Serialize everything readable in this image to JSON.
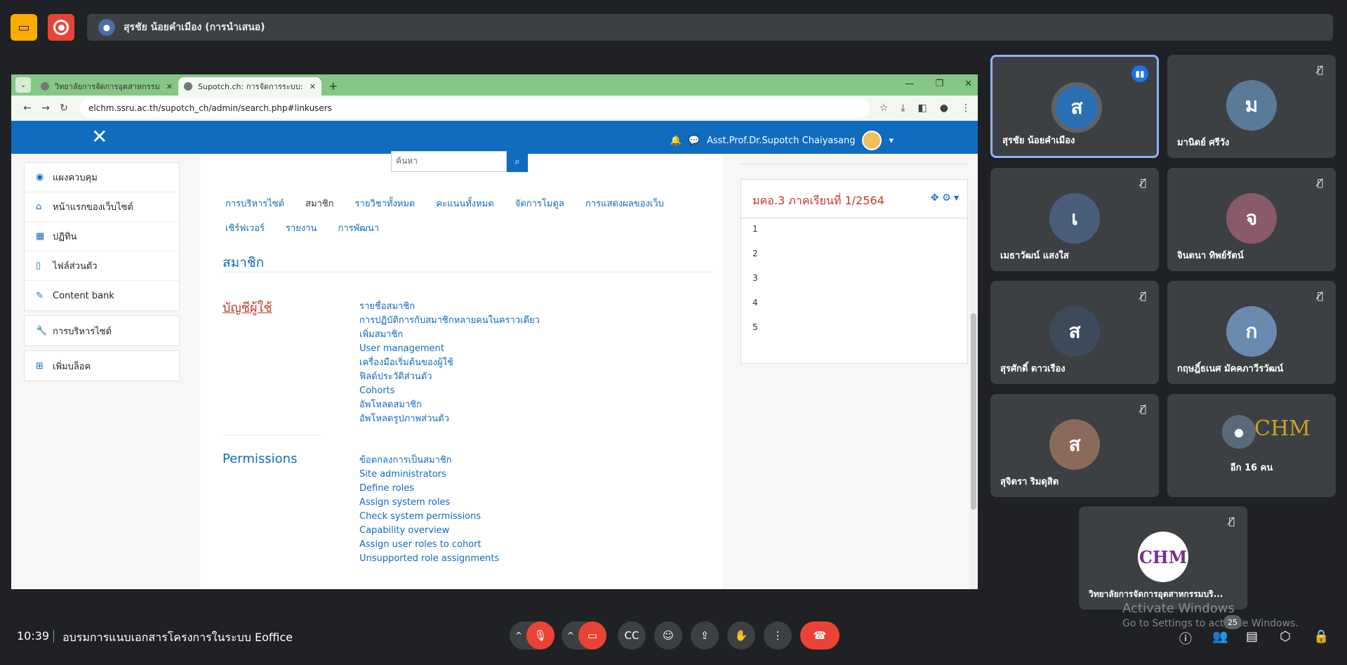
{
  "top": {
    "presenter": "สุรชัย น้อยคำเมือง (การนำเสนอ)"
  },
  "browser": {
    "tabs": [
      {
        "label": "วิทยาลัยการจัดการอุตสาหกรรม และ"
      },
      {
        "label": "Supotch.ch: การจัดการระบบ: ค้นหา"
      }
    ],
    "url": "elchm.ssru.ac.th/supotch_ch/admin/search.php#linkusers"
  },
  "moodle": {
    "user": "Asst.Prof.Dr.Supotch Chaiyasang",
    "nav": [
      {
        "label": "แผงควบคุม",
        "icon": "dashboard-icon"
      },
      {
        "label": "หน้าแรกของเว็บไซต์",
        "icon": "home-icon"
      },
      {
        "label": "ปฏิทิน",
        "icon": "calendar-icon"
      },
      {
        "label": "ไฟล์ส่วนตัว",
        "icon": "file-icon"
      },
      {
        "label": "Content bank",
        "icon": "brush-icon"
      }
    ],
    "nav2": {
      "label": "การบริหารไซต์"
    },
    "nav3": {
      "label": "เพิ่มบล็อค"
    },
    "search_placeholder": "ค้นหา",
    "cat_tabs": [
      "การบริหารไซต์",
      "สมาชิก",
      "รายวิชาทั้งหมด",
      "คะแนนทั้งหมด",
      "จัดการโมดูล",
      "การแสดงผลของเว็บ",
      "เซิร์ฟเวอร์",
      "รายงาน",
      "การพัฒนา"
    ],
    "section_title": "สมาชิก",
    "accounts_title": "บัญชีผู้ใช้",
    "accounts_links": [
      "รายชื่อสมาชิก",
      "การปฏิบัติการกับสมาชิกหลายคนในคราวเดียว",
      "เพิ่มสมาชิก",
      "User management",
      "เครื่องมือเริ่มต้นของผู้ใช้",
      "ฟิลด์ประวัติส่วนตัว",
      "Cohorts",
      "อัพโหลดสมาชิก",
      "อัพโหลดรูปภาพส่วนตัว"
    ],
    "permissions_title": "Permissions",
    "permissions_links": [
      "ข้อตกลงการเป็นสมาชิก",
      "Site administrators",
      "Define roles",
      "Assign system roles",
      "Check system permissions",
      "Capability overview",
      "Assign user roles to cohort",
      "Unsupported role assignments"
    ],
    "block_title": "มคอ.3 ภาคเรียนที่ 1/2564",
    "block_rows": [
      "1",
      "2",
      "3",
      "4",
      "5"
    ]
  },
  "participants": [
    {
      "name": "สุรชัย น้อยคำเมือง",
      "color": "#2d6fb5",
      "speaking": true
    },
    {
      "name": "มานิตย์ ศรีวัง",
      "color": "#5a7a9a"
    },
    {
      "name": "เมธาวัฒน์ แสงใส",
      "color": "#4a5d7a"
    },
    {
      "name": "จินตนา ทิพย์รัตน์",
      "color": "#8a5a6a"
    },
    {
      "name": "สุรศักดิ์ ดาวเรือง",
      "color": "#3d4a5a"
    },
    {
      "name": "กฤษฎิ์ธเนศ มัคคภาวีรวัฒน์",
      "color": "#6a8ab0"
    },
    {
      "name": "สุจิตรา ริมดุสิต",
      "color": "#8a6a5a"
    },
    {
      "name": "อีก 16 คน",
      "color": "#c9a227"
    },
    {
      "name": "วิทยาลัยการจัดการอุตสาหกรรมบริ...",
      "color": "#ffffff"
    }
  ],
  "bottom": {
    "time": "10:39",
    "meeting": "อบรมการแนบเอกสารโครงการในระบบ Eoffice",
    "watermark_title": "Activate Windows",
    "watermark_sub": "Go to Settings to activate Windows.",
    "people_count": "25"
  }
}
